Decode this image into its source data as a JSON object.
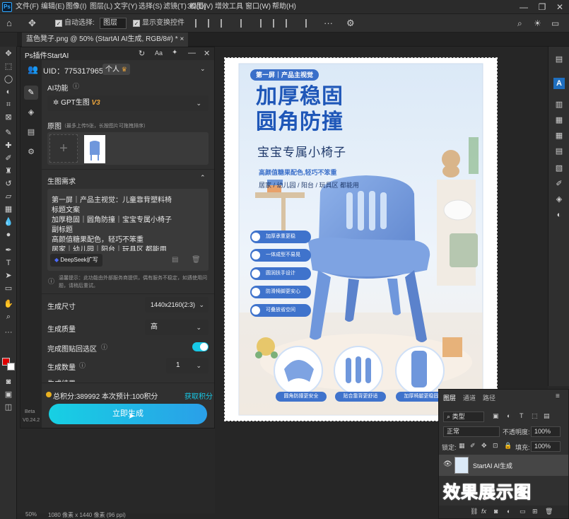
{
  "app": {
    "logo": "Ps"
  },
  "menubar": {
    "items": [
      "文件(F)",
      "编辑(E)",
      "图像(I)",
      "图层(L)",
      "文字(Y)",
      "选择(S)",
      "滤镜(T)",
      "3D(D)",
      "视图(V)",
      "增效工具",
      "窗口(W)",
      "帮助(H)"
    ]
  },
  "window_controls": {
    "minimize": "—",
    "restore": "❐",
    "close": "✕"
  },
  "options": {
    "auto_select_label": "自动选择:",
    "auto_select_value": "图层",
    "show_transform_label": "显示变换控件"
  },
  "document_tab": {
    "title": "蓝色凳子.png @ 50% (StartAI AI生成, RGB/8#) *",
    "close": "×"
  },
  "plugin": {
    "title": "Ps插件StartAI",
    "uid": "UID：775317965",
    "plan": "个人",
    "ai_function_label": "AI功能",
    "ai_function_value": "GPT生图",
    "ai_function_version": "V3",
    "source_image_label": "原图",
    "source_image_hint": "（最多上传5张，长按图片可拖拽排序）",
    "add_symbol": "+",
    "requirement_label": "生图需求",
    "requirement_lines": [
      "第一屏｜产品主视觉：儿童靠背塑料椅",
      "标题文案",
      "加厚稳固｜圆角防撞｜宝宝专属小椅子",
      "副标题",
      "高颜值糖果配色，轻巧不笨重",
      "居家｜幼儿园｜阳台｜玩具区 都能用"
    ],
    "deepseek_label": "DeepSeek扩写",
    "tip": "温馨提示：此功能由外部服务商提供，偶有服务不稳定，如遇使用问题，请稍后重试。",
    "size_label": "生成尺寸",
    "size_value": "1440x2160(2:3)",
    "quality_label": "生成质量",
    "quality_value": "高",
    "paste_back_label": "完成图贴回选区",
    "paste_back_on": true,
    "count_label": "生成数量",
    "count_value": "1",
    "cut_label": "生成结果",
    "points_text": "总积分:389992  本次预计:100积分",
    "get_points": "获取积分",
    "generate_button": "立即生成",
    "beta_label": "Beta",
    "version_label": "V0.24.2",
    "accent_color": "#17c8e6"
  },
  "poster": {
    "tag": "第一屏｜产品主视觉",
    "title_line1": "加厚稳固",
    "title_line2": "圆角防撞",
    "subtitle": "宝宝专属小椅子",
    "slogan": "高颜值糖果配色,轻巧不笨重",
    "scenes": "居家 / 幼儿园 / 阳台 / 玩具区 都能用",
    "features": [
      "加厚承重更稳",
      "一体成型不易晃",
      "圆润扶手设计",
      "防滑椅脚更安心",
      "可叠放省空间"
    ],
    "details": [
      "圆角防撞更安全",
      "贴合靠背更舒适",
      "加厚椅腿更稳固"
    ],
    "chair_color": "#6f97dc"
  },
  "layers": {
    "tabs": [
      "图层",
      "通道",
      "路径"
    ],
    "kind_label": "类型",
    "blend_mode": "正常",
    "opacity_label": "不透明度:",
    "opacity_value": "100%",
    "lock_label": "锁定:",
    "fill_label": "填充:",
    "fill_value": "100%",
    "layer_name": "StartAI AI生成"
  },
  "overlay_caption": "效果展示图",
  "status": {
    "zoom": "50%",
    "dims": "1080 像素 x 1440 像素 (96 ppi)"
  }
}
